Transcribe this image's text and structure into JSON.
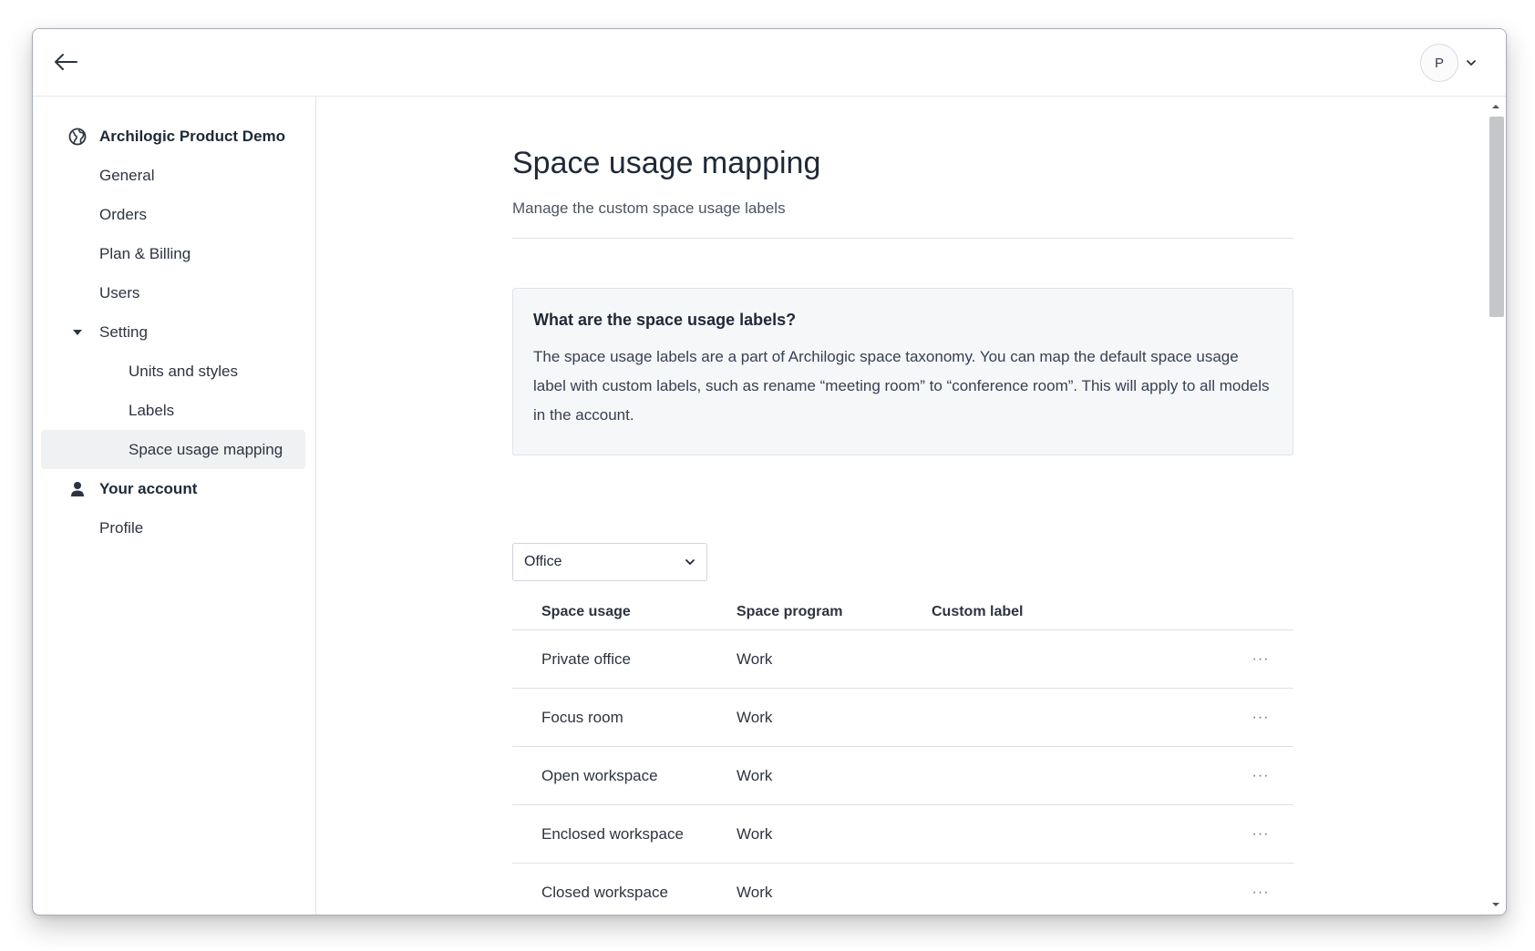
{
  "topbar": {
    "back_icon": "arrow-left-icon",
    "avatar_initial": "P",
    "avatar_menu_icon": "chevron-down-icon"
  },
  "sidebar": {
    "org_name": "Archilogic Product Demo",
    "org_icon": "globe-icon",
    "items": [
      {
        "label": "General"
      },
      {
        "label": "Orders"
      },
      {
        "label": "Plan & Billing"
      },
      {
        "label": "Users"
      }
    ],
    "setting": {
      "label": "Setting",
      "icon": "caret-down-icon",
      "children": [
        {
          "label": "Units and styles"
        },
        {
          "label": "Labels"
        },
        {
          "label": "Space usage mapping",
          "active": true
        }
      ]
    },
    "account": {
      "label": "Your account",
      "icon": "user-icon",
      "children": [
        {
          "label": "Profile"
        }
      ]
    }
  },
  "main": {
    "title": "Space usage mapping",
    "subtitle": "Manage the custom space usage labels",
    "info": {
      "title": "What are the space usage labels?",
      "text": "The space usage labels are a part of Archilogic space taxonomy. You can map the default space usage label with custom labels, such as rename “meeting room” to “conference room”. This will apply to all models in the account."
    },
    "category_select": {
      "value": "Office"
    },
    "table": {
      "columns": [
        "Space usage",
        "Space program",
        "Custom label"
      ],
      "rows": [
        {
          "usage": "Private office",
          "program": "Work",
          "custom": ""
        },
        {
          "usage": "Focus room",
          "program": "Work",
          "custom": ""
        },
        {
          "usage": "Open workspace",
          "program": "Work",
          "custom": ""
        },
        {
          "usage": "Enclosed workspace",
          "program": "Work",
          "custom": ""
        },
        {
          "usage": "Closed workspace",
          "program": "Work",
          "custom": ""
        }
      ],
      "row_menu_label": "···"
    }
  },
  "colors": {
    "active_bg": "#f0f1f3",
    "info_bg": "#f6f7f9",
    "border": "#dde1e6",
    "text": "#1f2937"
  }
}
